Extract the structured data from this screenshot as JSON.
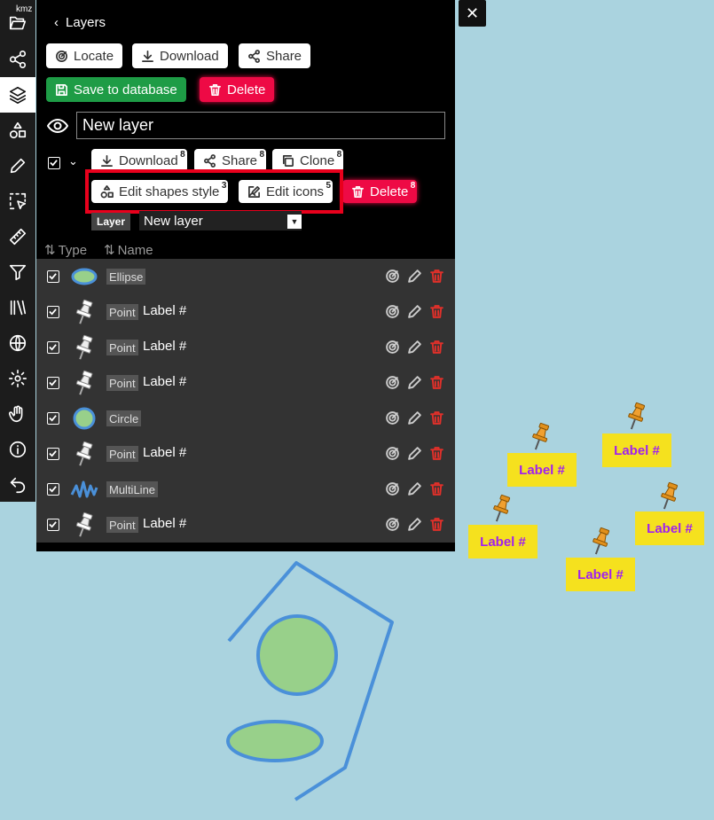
{
  "window": {
    "close_label": "✕"
  },
  "rail": {
    "kmz_tag": "kmz",
    "items": [
      {
        "name": "open-folder"
      },
      {
        "name": "share"
      },
      {
        "name": "layers"
      },
      {
        "name": "shapes"
      },
      {
        "name": "pencil"
      },
      {
        "name": "select"
      },
      {
        "name": "ruler"
      },
      {
        "name": "filter"
      },
      {
        "name": "library"
      },
      {
        "name": "globe"
      },
      {
        "name": "settings"
      },
      {
        "name": "hand"
      },
      {
        "name": "info"
      },
      {
        "name": "undo"
      }
    ]
  },
  "panel": {
    "title": "Layers",
    "toolbar": {
      "locate": "Locate",
      "download": "Download",
      "share": "Share"
    },
    "actions": {
      "save": "Save to database",
      "delete": "Delete"
    },
    "layer_name_value": "New layer",
    "layer_actions": {
      "download": "Download",
      "download_count": "8",
      "share": "Share",
      "share_count": "8",
      "clone": "Clone",
      "clone_count": "8",
      "edit_shapes_style": "Edit shapes style",
      "edit_shapes_count": "3",
      "edit_icons": "Edit icons",
      "edit_icons_count": "5",
      "delete": "Delete",
      "delete_count": "8"
    },
    "layer_chip": "Layer",
    "layer_select_value": "New layer",
    "columns": {
      "type": "Type",
      "name": "Name"
    },
    "rows": [
      {
        "type": "Ellipse",
        "name": ""
      },
      {
        "type": "Point",
        "name": "Label #"
      },
      {
        "type": "Point",
        "name": "Label #"
      },
      {
        "type": "Point",
        "name": "Label #"
      },
      {
        "type": "Circle",
        "name": ""
      },
      {
        "type": "Point",
        "name": "Label #"
      },
      {
        "type": "MultiLine",
        "name": ""
      },
      {
        "type": "Point",
        "name": "Label #"
      }
    ]
  },
  "map": {
    "labels": [
      "Label #",
      "Label #",
      "Label #",
      "Label #",
      "Label #"
    ],
    "colors": {
      "water": "#aad3df",
      "shape_stroke": "#4a90d9",
      "shape_fill": "#98d08a",
      "label_bg": "#f5e11e",
      "label_text": "#a020f0"
    }
  }
}
